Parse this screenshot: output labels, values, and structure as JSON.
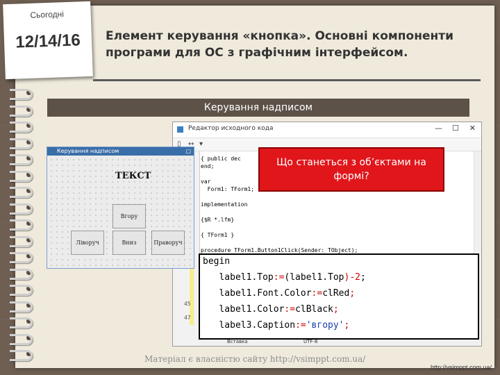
{
  "note": {
    "label": "Сьогодні",
    "date": "12/14/16"
  },
  "slide": {
    "title": "Елемент керування «кнопка». Основні компоненти програми для ОС з графічним інтерфейсом.",
    "banner": "Керування надписом"
  },
  "editor": {
    "title": "Редактор исходного кода",
    "controls": [
      "—",
      "☐",
      "✕"
    ],
    "code_lines": [
      "{ public dec",
      "end;",
      "",
      "var",
      "  Form1: TForm1;",
      "",
      "implementation",
      "",
      "{$R *.lfm}",
      "",
      "{ TForm1 }",
      "",
      "procedure TForm1.Button1Click(Sender: TObject);"
    ],
    "gutter_numbers": [
      "45",
      "47"
    ],
    "status": [
      "Вставка",
      "UTF-8"
    ]
  },
  "form": {
    "title": "Керування надписом",
    "label_text": "ТЕКСТ",
    "buttons": {
      "up": "Вгору",
      "left": "Ліворуч",
      "down": "Вниз",
      "right": "Праворуч"
    }
  },
  "callout": {
    "text": "Що станеться з об’єктами на формі?"
  },
  "code_zoom": {
    "lines": [
      {
        "parts": [
          [
            "kw",
            "begin"
          ]
        ]
      },
      {
        "parts": [
          [
            "kw",
            "   label1.Top"
          ],
          [
            "op",
            ":="
          ],
          [
            "kw",
            "(label1.Top"
          ],
          [
            "op",
            ")-2"
          ],
          [
            "kw",
            ";"
          ]
        ]
      },
      {
        "parts": [
          [
            "kw",
            "   label1.Font.Color"
          ],
          [
            "op",
            ":="
          ],
          [
            "kw",
            "clRed"
          ],
          [
            "op",
            ";"
          ]
        ]
      },
      {
        "parts": [
          [
            "kw",
            "   label1.Color"
          ],
          [
            "op",
            ":="
          ],
          [
            "kw",
            "clBlack"
          ],
          [
            "op",
            ";"
          ]
        ]
      },
      {
        "parts": [
          [
            "kw",
            "   label3.Caption"
          ],
          [
            "op",
            ":="
          ],
          [
            "str",
            "'вгору'"
          ],
          [
            "op",
            ";"
          ]
        ]
      }
    ]
  },
  "footer": {
    "text": "Матеріал є власністю сайту http://vsimppt.com.ua/",
    "url": "http://vsimppt.com.ua/"
  }
}
